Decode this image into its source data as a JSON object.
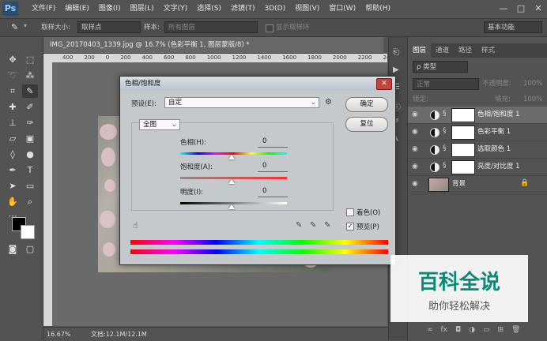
{
  "app": {
    "logo": "Ps"
  },
  "menu": [
    "文件(F)",
    "编辑(E)",
    "图像(I)",
    "图层(L)",
    "文字(Y)",
    "选择(S)",
    "滤镜(T)",
    "3D(D)",
    "视图(V)",
    "窗口(W)",
    "帮助(H)"
  ],
  "window_controls": {
    "min": "—",
    "max": "□",
    "close": "✕"
  },
  "options_bar": {
    "sample_size_label": "取样大小:",
    "sample_size_value": "取样点",
    "sample_label": "样本:",
    "sample_value": "所有图层",
    "show_ring": "显示取样环",
    "workspace": "基本功能"
  },
  "document": {
    "tab_title": "IMG_20170403_1339.jpg @ 16.7% (色彩平衡 1, 图层蒙版/8) *",
    "ruler_marks": [
      "400",
      "200",
      "0",
      "200",
      "400",
      "600",
      "800",
      "1000",
      "1200",
      "1400",
      "1600",
      "1800",
      "2000",
      "2200",
      "2400"
    ],
    "zoom": "16.67%",
    "doc_size": "文档:12.1M/12.1M"
  },
  "panel": {
    "tabs": [
      "图层",
      "通道",
      "路径",
      "样式"
    ],
    "kind_filter": "ρ 类型",
    "blend_mode": "正常",
    "opacity_label": "不透明度:",
    "opacity_value": "100%",
    "lock_label": "锁定:",
    "fill_label": "填充:",
    "fill_value": "100%",
    "layers": [
      {
        "name": "色相/饱和度 1"
      },
      {
        "name": "色彩平衡 1"
      },
      {
        "name": "选取颜色 1"
      },
      {
        "name": "亮度/对比度 1"
      },
      {
        "name": "背景"
      }
    ]
  },
  "dialog": {
    "title": "色相/饱和度",
    "preset_label": "预设(E):",
    "preset_value": "自定",
    "ok": "确定",
    "reset": "复位",
    "channel": "全图",
    "hue_label": "色相(H):",
    "hue_value": "0",
    "saturation_label": "饱和度(A):",
    "saturation_value": "0",
    "lightness_label": "明度(I):",
    "lightness_value": "0",
    "colorize_label": "着色(O)",
    "preview_label": "预览(P)",
    "close": "✕"
  },
  "watermark": {
    "title": "百科全说",
    "subtitle": "助你轻松解决"
  }
}
